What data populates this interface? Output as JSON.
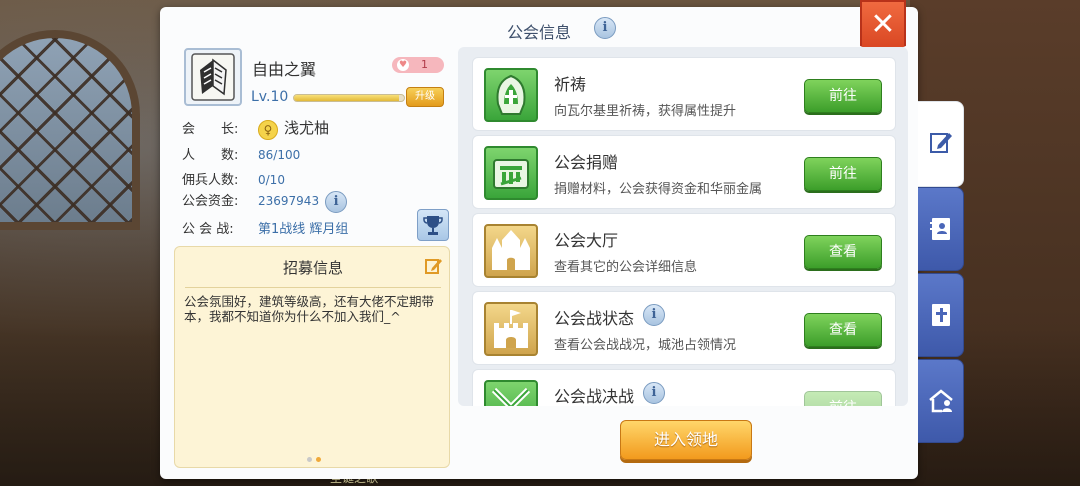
{
  "window": {
    "title": "公会信息"
  },
  "guild": {
    "name": "自由之翼",
    "rank": "1",
    "level": "Lv.10",
    "upgrade_label": "升级",
    "exp_fraction": 0.95,
    "leader_label": "会　　长:",
    "leader": "浅尤柚",
    "members_label": "人　　数:",
    "members": "86/100",
    "mercs_label": "佣兵人数:",
    "mercs": "0/10",
    "funds_label": "公会资金:",
    "funds": "23697943",
    "war_label": "公 会 战:",
    "war": "第1战线  辉月组"
  },
  "recruit": {
    "title": "招募信息",
    "text": "公会氛围好，建筑等级高，还有大佬不定期带本，我都不知道你为什么不加入我们_^"
  },
  "features": [
    {
      "name": "祈祷",
      "desc": "向瓦尔基里祈祷，获得属性提升",
      "button": "前往",
      "icon": "pray-icon"
    },
    {
      "name": "公会捐赠",
      "desc": "捐赠材料，公会获得资金和华丽金属",
      "button": "前往",
      "icon": "donate-icon"
    },
    {
      "name": "公会大厅",
      "desc": "查看其它的公会详细信息",
      "button": "查看",
      "icon": "castle-icon"
    },
    {
      "name": "公会战状态",
      "desc": "查看公会战战况，城池占领情况",
      "button": "查看",
      "icon": "fort-icon"
    },
    {
      "name": "公会战决战",
      "desc": "",
      "button": "前往",
      "icon": "crossed-swords-icon"
    }
  ],
  "enter_button": "进入领地",
  "side_tabs": [
    "edit-icon",
    "contacts-icon",
    "bible-icon",
    "home-people-icon"
  ],
  "background_caption": "圣诞之歌",
  "colors": {
    "accent_blue": "#3c6fa8",
    "button_green": "#3c9e2a",
    "button_orange": "#f29a1d",
    "close_red": "#d6421f",
    "tab_blue": "#4a66b8"
  }
}
